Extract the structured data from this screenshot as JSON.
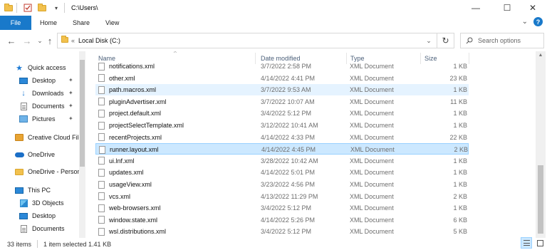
{
  "window": {
    "title": "C:\\Users\\",
    "controls": {
      "minimize": "—",
      "maximize": "☐",
      "close": "✕"
    }
  },
  "ribbon": {
    "tabs": [
      "File",
      "Home",
      "Share",
      "View"
    ],
    "expand": "⌄",
    "help": "?"
  },
  "address": {
    "back": "←",
    "forward": "→",
    "recent": "⌄",
    "up": "↑",
    "separator": "«",
    "crumb": "Local Disk (C:)",
    "dropdown": "⌄",
    "refresh": "↻",
    "search_placeholder": "Search options"
  },
  "nav_pane": {
    "quick_access": "Quick access",
    "items": [
      {
        "label": "Desktop",
        "icon": "desktop-icon",
        "pinned": true
      },
      {
        "label": "Downloads",
        "icon": "download-icon",
        "pinned": true
      },
      {
        "label": "Documents",
        "icon": "documents-icon",
        "pinned": true
      },
      {
        "label": "Pictures",
        "icon": "pictures-icon",
        "pinned": true
      }
    ],
    "creative_cloud": "Creative Cloud File",
    "onedrive": "OneDrive",
    "onedrive_personal": "OneDrive - Person",
    "this_pc": "This PC",
    "pc_items": [
      {
        "label": "3D Objects",
        "icon": "3d-objects-icon"
      },
      {
        "label": "Desktop",
        "icon": "desktop-icon"
      },
      {
        "label": "Documents",
        "icon": "documents-icon"
      }
    ],
    "pin_glyph": "📌"
  },
  "file_list": {
    "columns": {
      "name": "Name",
      "date": "Date modified",
      "type": "Type",
      "size": "Size"
    },
    "rows": [
      {
        "name": "notifications.xml",
        "date": "3/7/2022 2:58 PM",
        "type": "XML Document",
        "size": "1 KB"
      },
      {
        "name": "other.xml",
        "date": "4/14/2022 4:41 PM",
        "type": "XML Document",
        "size": "23 KB"
      },
      {
        "name": "path.macros.xml",
        "date": "3/7/2022 9:53 AM",
        "type": "XML Document",
        "size": "1 KB"
      },
      {
        "name": "pluginAdvertiser.xml",
        "date": "3/7/2022 10:07 AM",
        "type": "XML Document",
        "size": "11 KB"
      },
      {
        "name": "project.default.xml",
        "date": "3/4/2022 5:12 PM",
        "type": "XML Document",
        "size": "1 KB"
      },
      {
        "name": "projectSelectTemplate.xml",
        "date": "3/12/2022 10:41 AM",
        "type": "XML Document",
        "size": "1 KB"
      },
      {
        "name": "recentProjects.xml",
        "date": "4/14/2022 4:33 PM",
        "type": "XML Document",
        "size": "22 KB"
      },
      {
        "name": "runner.layout.xml",
        "date": "4/14/2022 4:45 PM",
        "type": "XML Document",
        "size": "2 KB"
      },
      {
        "name": "ui.lnf.xml",
        "date": "3/28/2022 10:42 AM",
        "type": "XML Document",
        "size": "1 KB"
      },
      {
        "name": "updates.xml",
        "date": "4/14/2022 5:01 PM",
        "type": "XML Document",
        "size": "1 KB"
      },
      {
        "name": "usageView.xml",
        "date": "3/23/2022 4:56 PM",
        "type": "XML Document",
        "size": "1 KB"
      },
      {
        "name": "vcs.xml",
        "date": "4/13/2022 11:29 PM",
        "type": "XML Document",
        "size": "2 KB"
      },
      {
        "name": "web-browsers.xml",
        "date": "3/4/2022 5:12 PM",
        "type": "XML Document",
        "size": "1 KB"
      },
      {
        "name": "window.state.xml",
        "date": "4/14/2022 5:26 PM",
        "type": "XML Document",
        "size": "6 KB"
      },
      {
        "name": "wsl.distributions.xml",
        "date": "3/4/2022 5:12 PM",
        "type": "XML Document",
        "size": "5 KB"
      }
    ],
    "selected_row": "runner.layout.xml",
    "hovered_row": "path.macros.xml"
  },
  "status": {
    "count": "33 items",
    "selection": "1 item selected  1.41 KB"
  },
  "colors": {
    "accent": "#1979ca",
    "selection": "#cce8ff",
    "selection_border": "#99d1ff",
    "hover": "#e5f3ff"
  }
}
